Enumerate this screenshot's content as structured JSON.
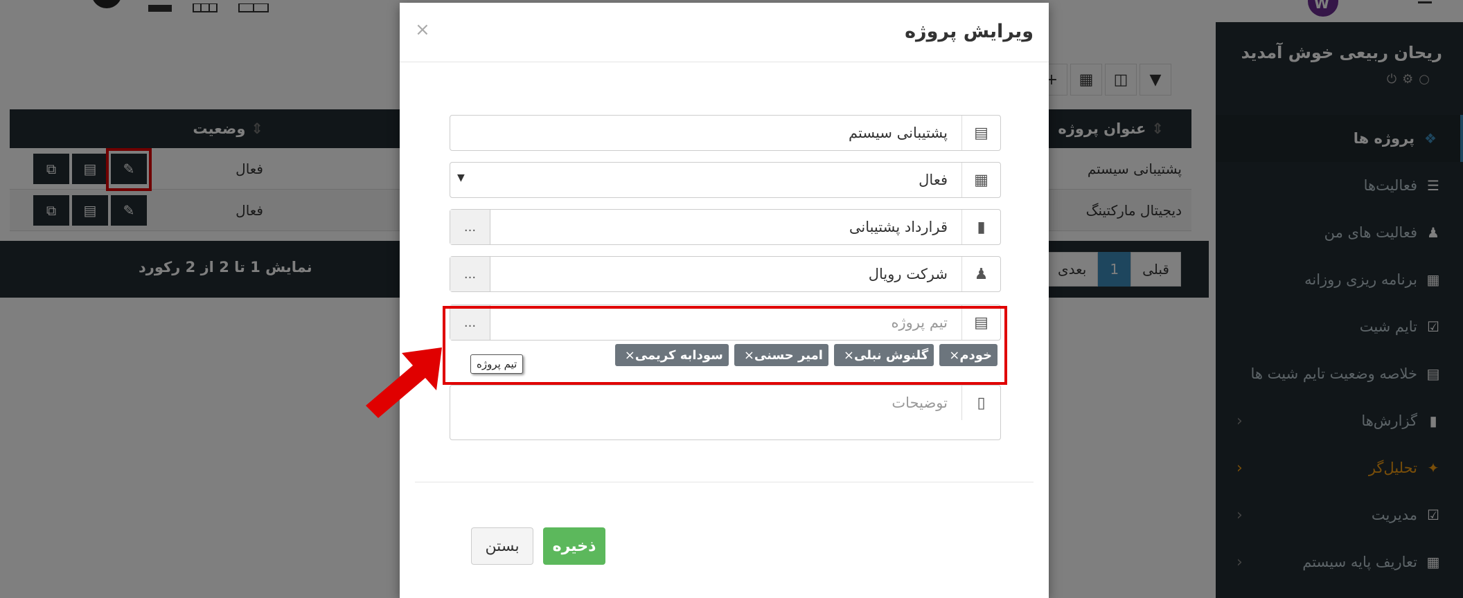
{
  "colors": {
    "sidebar_bg": "#222d32",
    "accent_blue": "#3c8dbc",
    "save_green": "#5cb85c",
    "highlight_red": "#e00000",
    "analyst_orange": "#f39c12"
  },
  "sidebar": {
    "welcome": "ریحان ربیعی خوش آمدید",
    "items": [
      {
        "label": "پروژه ها",
        "icon": "cubes-icon"
      },
      {
        "label": "فعالیت‌ها",
        "icon": "list-icon"
      },
      {
        "label": "فعالیت های من",
        "icon": "user-task-icon"
      },
      {
        "label": "برنامه ریزی روزانه",
        "icon": "table-icon"
      },
      {
        "label": "تایم شیت",
        "icon": "calendar-check-icon"
      },
      {
        "label": "خلاصه وضعیت تایم شیت ها",
        "icon": "summary-icon"
      },
      {
        "label": "گزارش‌ها",
        "icon": "file-icon"
      },
      {
        "label": "تحلیل‌گر",
        "icon": "wand-icon"
      },
      {
        "label": "مدیریت",
        "icon": "check-square-icon"
      },
      {
        "label": "تعاریف پایه سیستم",
        "icon": "grid-icon"
      }
    ]
  },
  "table": {
    "headers": {
      "title": "عنوان پروژه",
      "status": "وضعیت"
    },
    "rows": [
      {
        "title": "پشتیبانی سیستم",
        "status": "فعال"
      },
      {
        "title": "دیجیتال مارکتینگ",
        "status": "فعال"
      }
    ],
    "records_info": "نمایش 1 تا 2 از 2 رکورد",
    "pager": {
      "prev": "قبلی",
      "current": "1",
      "next": "بعدی"
    }
  },
  "modal": {
    "title": "ویرایش پروژه",
    "close": "×",
    "fields": {
      "project_title": "پشتیبانی سیستم",
      "status": "فعال",
      "contract": "قرارداد پشتیبانی",
      "customer": "شرکت رویال",
      "team_placeholder": "تیم پروژه",
      "description_placeholder": "توضیحات",
      "dots": "..."
    },
    "team_tags": [
      "خودم",
      "گلنوش نبلی",
      "امیر حسنی",
      "سودابه کریمی"
    ],
    "tag_remove": "×",
    "tooltip": "تیم پروژه",
    "buttons": {
      "save": "ذخیره",
      "close": "بستن"
    }
  }
}
